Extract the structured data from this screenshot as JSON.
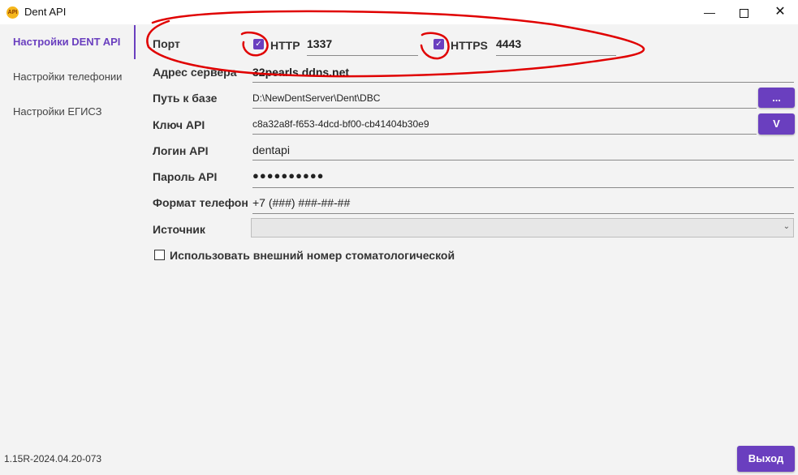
{
  "window": {
    "title": "Dent API",
    "app_icon_text": "API",
    "controls": {
      "minimize": "—",
      "close": "✕"
    }
  },
  "sidebar": {
    "items": [
      {
        "label": "Настройки DENT API",
        "active": true
      },
      {
        "label": "Настройки телефонии",
        "active": false
      },
      {
        "label": "Настройки ЕГИСЗ",
        "active": false
      }
    ],
    "version": "1.15R-2024.04.20-073"
  },
  "form": {
    "port": {
      "label": "Порт",
      "http": {
        "label": "HTTP",
        "checked": true,
        "value": "1337"
      },
      "https": {
        "label": "HTTPS",
        "checked": true,
        "value": "4443"
      }
    },
    "server_address": {
      "label": "Адрес сервера",
      "value": "32pearls.ddns.net"
    },
    "db_path": {
      "label": "Путь к базе",
      "value": "D:\\NewDentServer\\Dent\\DBC",
      "button": "..."
    },
    "api_key": {
      "label": "Ключ API",
      "value": "c8a32a8f-f653-4dcd-bf00-cb41404b30e9",
      "button": "V"
    },
    "api_login": {
      "label": "Логин API",
      "value": "dentapi"
    },
    "api_password": {
      "label": "Пароль API",
      "value": "●●●●●●●●●●"
    },
    "phone_format": {
      "label": "Формат телефона",
      "value": "+7 (###) ###-##-##"
    },
    "source": {
      "label": "Источник",
      "value": ""
    },
    "external_number": {
      "label": "Использовать внешний номер стоматологической",
      "checked": false
    }
  },
  "footer": {
    "exit_button": "Выход"
  },
  "colors": {
    "accent": "#6a3fbf",
    "annotation": "#e00000",
    "background": "#f3f3f3"
  }
}
